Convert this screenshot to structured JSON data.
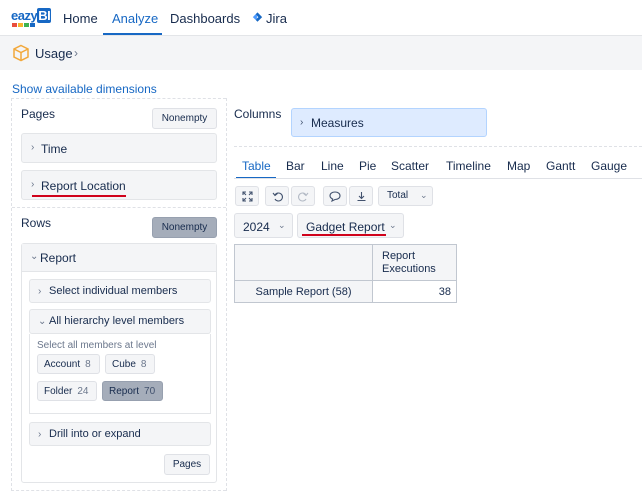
{
  "nav": {
    "logo_text": "eazyBI",
    "logo_colors": [
      "#e94e3d",
      "#f6b52c",
      "#3fb34f",
      "#1768c4"
    ],
    "home": "Home",
    "analyze": "Analyze",
    "dashboards": "Dashboards",
    "jira": "Jira"
  },
  "breadcrumb": {
    "cube_icon": "cube-icon",
    "title": "Usage",
    "chevron": "›"
  },
  "show_dimensions": "Show available dimensions",
  "pages": {
    "label": "Pages",
    "button": "Nonempty",
    "dimensions": [
      {
        "label": "Time"
      },
      {
        "label": "Report Location"
      }
    ]
  },
  "rows": {
    "label": "Rows",
    "button": "Nonempty",
    "dimension": "Report",
    "select_individual": "Select individual members",
    "all_hierarchy": "All hierarchy level members",
    "level_caption": "Select all members at level",
    "levels": [
      {
        "name": "Account",
        "count": "8"
      },
      {
        "name": "Cube",
        "count": "8"
      },
      {
        "name": "Folder",
        "count": "24"
      },
      {
        "name": "Report",
        "count": "70"
      }
    ],
    "drill": "Drill into or expand",
    "pages_button": "Pages"
  },
  "columns": {
    "label": "Columns",
    "measures": "Measures"
  },
  "tabs": [
    "Table",
    "Bar",
    "Line",
    "Pie",
    "Scatter",
    "Timeline",
    "Map",
    "Gantt",
    "Gauge"
  ],
  "toolbar": {
    "total_label": "Total"
  },
  "filters": {
    "year": "2024",
    "location": "Gadget Report"
  },
  "table": {
    "column_header_1": "Report",
    "column_header_2": "Executions",
    "row_label": "Sample Report (58)",
    "row_value": "38"
  },
  "colors": {
    "accent": "#1768c4",
    "highlight_underline": "#d0021b",
    "measures_bg": "#deebff"
  }
}
